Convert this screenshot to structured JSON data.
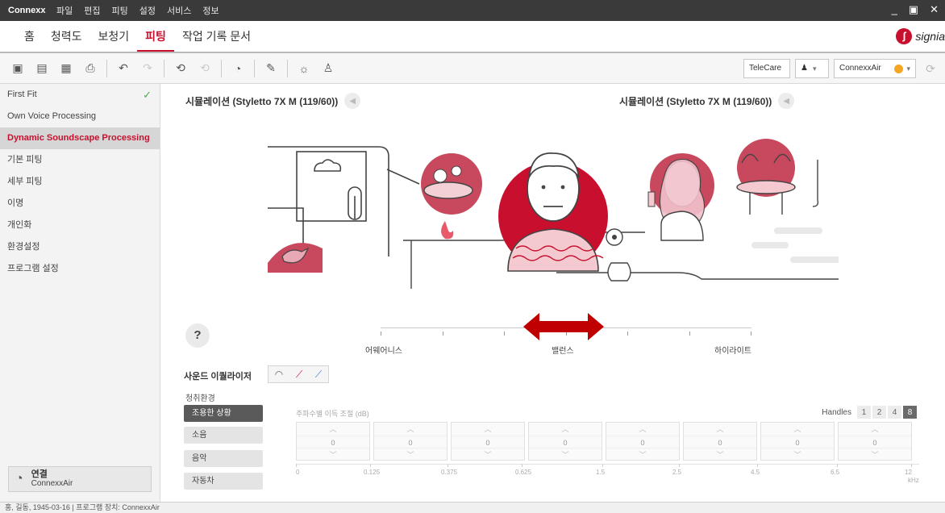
{
  "titlebar": {
    "app": "Connexx",
    "menu": [
      "파일",
      "편집",
      "피팅",
      "설정",
      "서비스",
      "정보"
    ]
  },
  "nav": {
    "tabs": [
      {
        "label": "홈",
        "active": false
      },
      {
        "label": "청력도",
        "active": false
      },
      {
        "label": "보청기",
        "active": false
      },
      {
        "label": "피팅",
        "active": true
      },
      {
        "label": "작업 기록 문서",
        "active": false
      }
    ],
    "brand": "signia"
  },
  "toolbar": {
    "telecare": "TeleCare",
    "device": "ConnexxAir"
  },
  "sidebar": {
    "items": [
      {
        "label": "First Fit",
        "checked": true
      },
      {
        "label": "Own Voice Processing"
      },
      {
        "label": "Dynamic Soundscape Processing",
        "active": true
      },
      {
        "label": "기본 피팅"
      },
      {
        "label": "세부 피팅"
      },
      {
        "label": "이명"
      },
      {
        "label": "개인화"
      },
      {
        "label": "환경설정"
      },
      {
        "label": "프로그램 설정"
      }
    ],
    "connect": {
      "title": "연결",
      "sub": "ConnexxAir"
    }
  },
  "main": {
    "sim_left": "시뮬레이션 (Styletto 7X M (119/60))",
    "sim_right": "시뮬레이션 (Styletto 7X M (119/60))",
    "help": "?",
    "slider": {
      "left": "어웨어니스",
      "center": "밸런스",
      "right": "하이라이트",
      "position": 0.5
    },
    "eq": {
      "title": "사운드 이퀄라이저",
      "env_label": "청취환경",
      "environments": [
        {
          "label": "조용한 상황",
          "active": true
        },
        {
          "label": "소음"
        },
        {
          "label": "음악"
        },
        {
          "label": "자동차"
        }
      ],
      "gain_label": "주파수별 이득 조절 (dB)",
      "handles_label": "Handles",
      "handles": [
        {
          "label": "1"
        },
        {
          "label": "2"
        },
        {
          "label": "4"
        },
        {
          "label": "8",
          "active": true
        }
      ],
      "gains": [
        "0",
        "0",
        "0",
        "0",
        "0",
        "0",
        "0",
        "0"
      ],
      "freqs": [
        "0",
        "0.125",
        "0.375",
        "0.625",
        "1.5",
        "2.5",
        "4.5",
        "6.5",
        "12"
      ],
      "freq_unit": "kHz"
    }
  },
  "status": "홍, 길동, 1945-03-16 | 프로그램 장치: ConnexxAir",
  "colors": {
    "accent": "#c8102e",
    "arrow": "#c00000"
  }
}
